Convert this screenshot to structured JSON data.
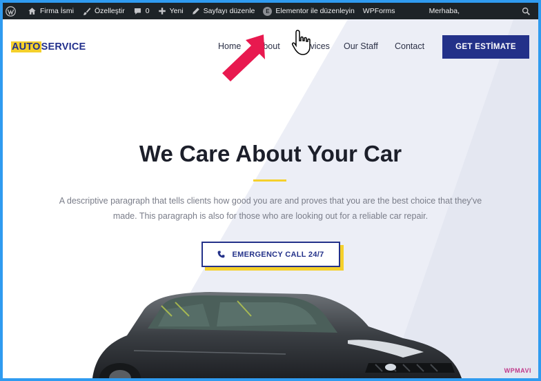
{
  "adminbar": {
    "site_name": "Firma İsmi",
    "customize": "Özelleştir",
    "comments_count": "0",
    "new": "Yeni",
    "edit_page": "Sayfayı düzenle",
    "elementor": "Elementor ile düzenleyin",
    "elementor_badge": "E",
    "wpforms": "WPForms",
    "greeting": "Merhaba,"
  },
  "header": {
    "logo_part1": "AUTO",
    "logo_part2": "SERVICE",
    "nav": [
      "Home",
      "About",
      "Services",
      "Our Staff",
      "Contact"
    ],
    "cta": "GET ESTİMATE"
  },
  "hero": {
    "title": "We Care About Your Car",
    "paragraph_line1": "A descriptive paragraph that tells clients how good you are and proves that you are the best choice that they've",
    "paragraph_line2": "made. This paragraph is also for those who are looking out for a reliable car repair.",
    "button": "EMERGENCY CALL 24/7"
  },
  "watermark": "WPMAVI",
  "colors": {
    "frame": "#2f9bf0",
    "adminbar": "#1d2327",
    "brand_blue": "#233189",
    "accent_yellow": "#f5d02b",
    "arrow_red": "#e8194f"
  },
  "icons": [
    "wordpress-icon",
    "home-icon",
    "brush-icon",
    "comment-icon",
    "plus-icon",
    "pencil-icon",
    "elementor-icon",
    "search-icon",
    "phone-icon",
    "hand-cursor-icon",
    "red-arrow-icon"
  ]
}
